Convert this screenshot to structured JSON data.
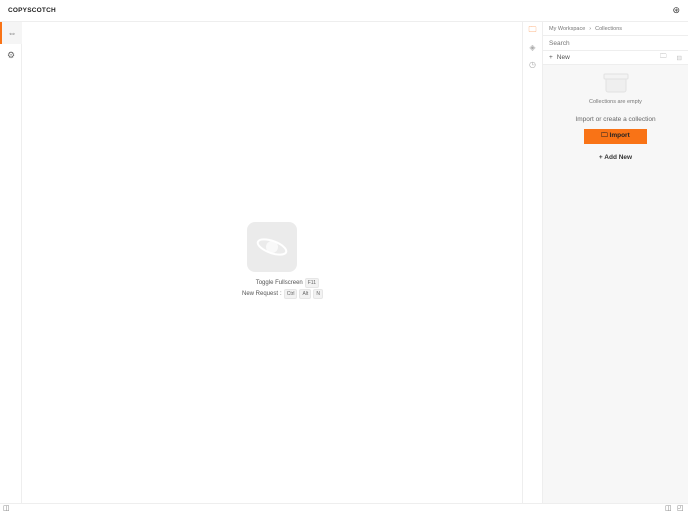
{
  "header": {
    "title": "COPYSCOTCH"
  },
  "left_nav": [
    {
      "icon": "rest-icon"
    },
    {
      "icon": "settings-icon"
    }
  ],
  "main": {
    "shortcuts": [
      {
        "label": "Toggle Fullscreen",
        "keys": [
          "F11"
        ]
      },
      {
        "label": "New Request",
        "keys": [
          "Ctrl",
          "Alt",
          "N"
        ]
      }
    ]
  },
  "panel": {
    "breadcrumb": [
      "My Workspace",
      "Collections"
    ],
    "search_placeholder": "Search",
    "new_label": "New",
    "empty_text": "Collections are empty",
    "hint": "Import or create a collection",
    "import_label": "Import",
    "add_new_label": "Add New"
  },
  "colors": {
    "accent": "#f97316"
  }
}
